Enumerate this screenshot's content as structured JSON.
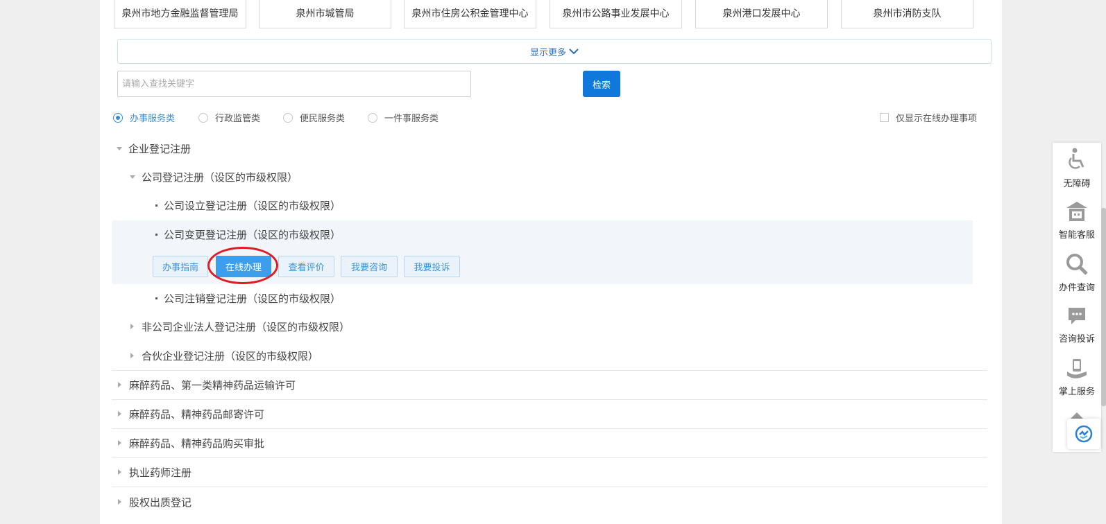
{
  "departments": [
    "泉州市地方金融监督管理局",
    "泉州市城管局",
    "泉州市住房公积金管理中心",
    "泉州市公路事业发展中心",
    "泉州港口发展中心",
    "泉州市消防支队"
  ],
  "show_more_label": "显示更多",
  "search": {
    "placeholder": "请输入查找关键字",
    "button_label": "检索"
  },
  "categories": [
    {
      "label": "办事服务类",
      "checked": true
    },
    {
      "label": "行政监管类",
      "checked": false
    },
    {
      "label": "便民服务类",
      "checked": false
    },
    {
      "label": "一件事服务类",
      "checked": false
    }
  ],
  "only_online_label": "仅显示在线办理事项",
  "tree": {
    "root": "企业登记注册",
    "sub_company": "公司登记注册（设区的市级权限）",
    "item_setup": "公司设立登记注册（设区的市级权限）",
    "item_change": "公司变更登记注册（设区的市级权限）",
    "item_cancel": "公司注销登记注册（设区的市级权限）",
    "sub_non_company": "非公司企业法人登记注册（设区的市级权限）",
    "sub_partnership": "合伙企业登记注册（设区的市级权限）"
  },
  "actions": [
    "办事指南",
    "在线办理",
    "查看评价",
    "我要咨询",
    "我要投诉"
  ],
  "top_items": [
    "麻醉药品、第一类精神药品运输许可",
    "麻醉药品、精神药品邮寄许可",
    "麻醉药品、精神药品购买审批",
    "执业药师注册",
    "股权出质登记"
  ],
  "side_panel": [
    {
      "label": "无障碍",
      "icon": "wheelchair-icon"
    },
    {
      "label": "智能客服",
      "icon": "robot-icon"
    },
    {
      "label": "办件查询",
      "icon": "search-icon"
    },
    {
      "label": "咨询投诉",
      "icon": "chat-bubble-icon"
    },
    {
      "label": "掌上服务",
      "icon": "mobile-hand-icon"
    }
  ],
  "colors": {
    "primary": "#1077db",
    "accent": "#3a8fd6",
    "highlight_ring": "#e01c24"
  }
}
